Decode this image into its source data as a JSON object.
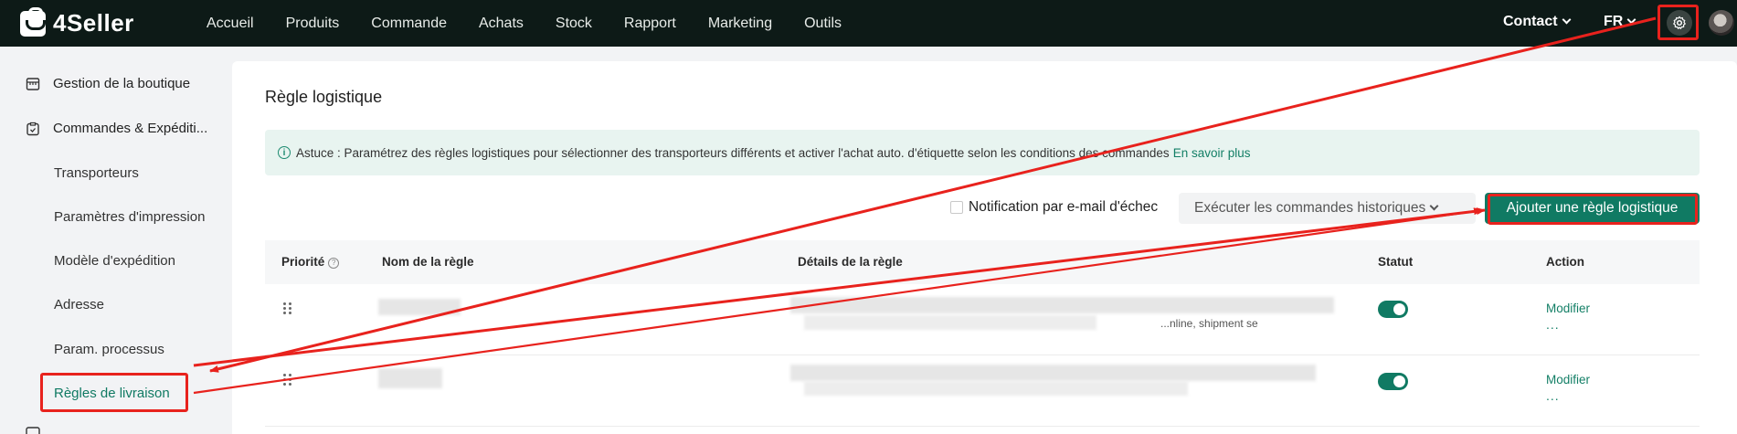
{
  "app": {
    "logo_text": "4Seller",
    "nav": [
      "Accueil",
      "Produits",
      "Commande",
      "Achats",
      "Stock",
      "Rapport",
      "Marketing",
      "Outils"
    ],
    "contact_label": "Contact",
    "lang_label": "FR"
  },
  "sidebar": {
    "groups": [
      {
        "label": "Gestion de la boutique",
        "icon": "shop-icon"
      },
      {
        "label": "Commandes & Expéditi...",
        "icon": "clipboard-icon"
      }
    ],
    "items": [
      "Transporteurs",
      "Paramètres d'impression",
      "Modèle d'expédition",
      "Adresse",
      "Param. processus",
      "Règles de livraison"
    ],
    "active_item": "Règles de livraison"
  },
  "main": {
    "title": "Règle logistique",
    "tip_text": "Astuce : Paramétrez des règles logistiques pour sélectionner des transporteurs différents et activer l'achat auto. d'étiquette selon les conditions des commandes",
    "tip_link": "En savoir plus",
    "notification_label": "Notification par e-mail d'échec",
    "execute_button": "Exécuter les commandes historiques",
    "add_button": "Ajouter une règle logistique",
    "table": {
      "columns": [
        "Priorité",
        "Nom de la règle",
        "Détails de la règle",
        "Statut",
        "Action"
      ],
      "rows": [
        {
          "status_on": true,
          "action": "Modifier",
          "more": "...",
          "details_partial": "...nline, shipment se"
        },
        {
          "status_on": true,
          "action": "Modifier",
          "more": "..."
        }
      ]
    }
  },
  "colors": {
    "topbar": "#0d1a17",
    "accent": "#107a63",
    "annotation": "#e8221d"
  }
}
